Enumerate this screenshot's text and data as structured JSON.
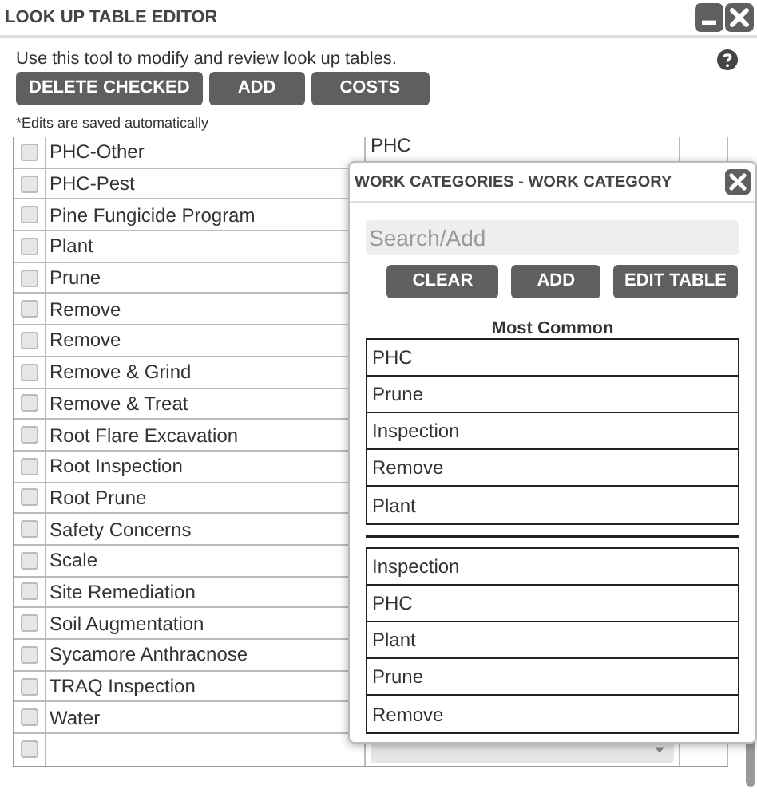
{
  "window": {
    "title": "LOOK UP TABLE EDITOR"
  },
  "description": "Use this tool to modify and review look up tables.",
  "buttons": [
    "DELETE CHECKED",
    "ADD",
    "COSTS"
  ],
  "note": "*Edits are saved automatically",
  "rows": [
    {
      "name": "PHC-Other",
      "checked": false,
      "column_2": "PHC"
    },
    {
      "name": "PHC-Pest",
      "checked": false
    },
    {
      "name": "Pine Fungicide Program",
      "checked": false
    },
    {
      "name": "Plant",
      "checked": false
    },
    {
      "name": "Prune",
      "checked": false
    },
    {
      "name": "Remove",
      "checked": false
    },
    {
      "name": "Remove",
      "checked": false
    },
    {
      "name": "Remove & Grind",
      "checked": false
    },
    {
      "name": "Remove & Treat",
      "checked": false
    },
    {
      "name": "Root Flare Excavation",
      "checked": false
    },
    {
      "name": "Root Inspection",
      "checked": false
    },
    {
      "name": "Root Prune",
      "checked": false
    },
    {
      "name": "Safety Concerns",
      "checked": false
    },
    {
      "name": "Scale",
      "checked": false
    },
    {
      "name": "Site Remediation",
      "checked": false
    },
    {
      "name": "Soil Augmentation",
      "checked": false
    },
    {
      "name": "Sycamore Anthracnose",
      "checked": false
    },
    {
      "name": "TRAQ Inspection",
      "checked": false
    },
    {
      "name": "Water",
      "checked": false
    },
    {
      "checked": false,
      "kind": "new"
    }
  ],
  "popup": {
    "title": "WORK CATEGORIES - WORK CATEGORY",
    "search": {
      "placeholder": "Search/Add"
    },
    "buttons": [
      "CLEAR",
      "ADD",
      "EDIT TABLE"
    ],
    "heading": "Most Common",
    "most_common": [
      "PHC",
      "Prune",
      "Inspection",
      "Remove",
      "Plant"
    ],
    "all": [
      "Inspection",
      "PHC",
      "Plant",
      "Prune",
      "Remove"
    ]
  }
}
